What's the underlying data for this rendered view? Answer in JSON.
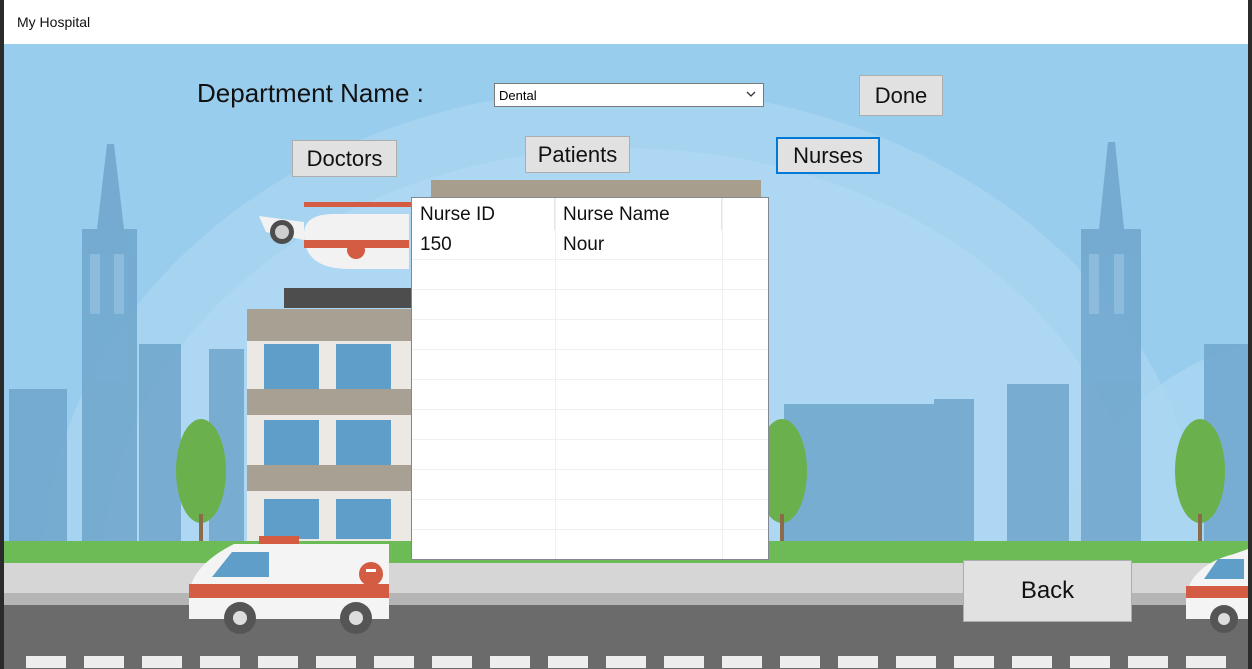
{
  "window": {
    "title": "My Hospital"
  },
  "form": {
    "department_label": "Department Name :",
    "department_value": "Dental",
    "done_label": "Done",
    "doctors_label": "Doctors",
    "patients_label": "Patients",
    "nurses_label": "Nurses",
    "back_label": "Back"
  },
  "grid": {
    "columns": [
      "Nurse ID",
      "Nurse Name"
    ],
    "rows": [
      {
        "id": "150",
        "name": "Nour"
      }
    ]
  }
}
